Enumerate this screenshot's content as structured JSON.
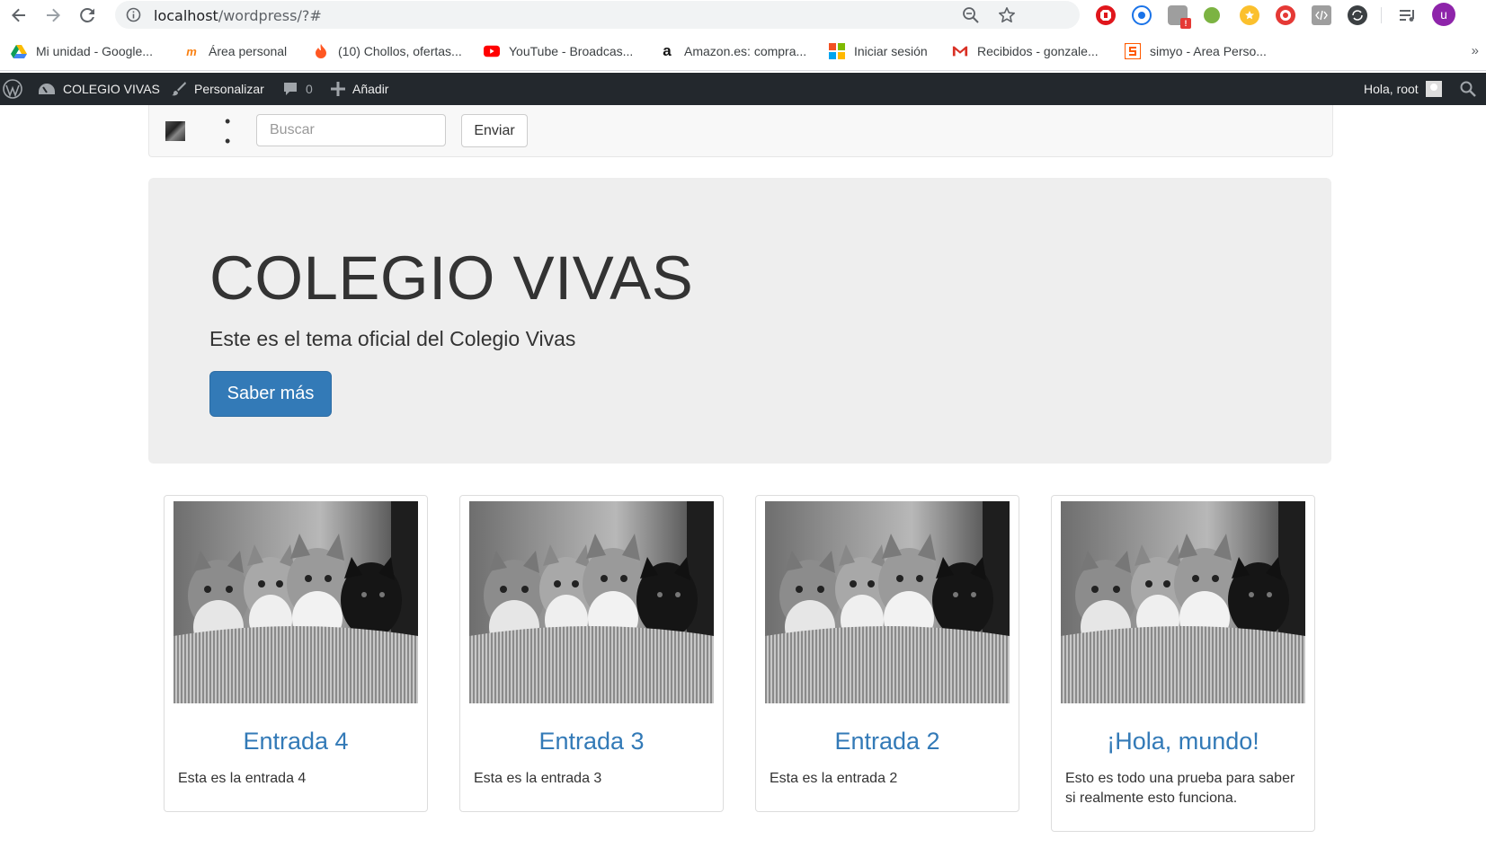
{
  "browser": {
    "url_host": "localhost",
    "url_path": "/wordpress/?#",
    "profile_initial": "u",
    "extensions": [
      "adblock-icon",
      "circle-extension-icon",
      "notes-extension-icon",
      "js-extension-icon",
      "star-extension-icon",
      "target-extension-icon",
      "code-extension-icon",
      "sync-extension-icon"
    ],
    "ext_badge": "!"
  },
  "bookmarks": [
    {
      "label": "Mi unidad - Google...",
      "icon": "google-drive-icon"
    },
    {
      "label": "Área personal",
      "icon": "moodle-icon"
    },
    {
      "label": "(10) Chollos, ofertas...",
      "icon": "flame-icon"
    },
    {
      "label": "YouTube - Broadcas...",
      "icon": "youtube-icon"
    },
    {
      "label": "Amazon.es: compra...",
      "icon": "amazon-icon"
    },
    {
      "label": "Iniciar sesión",
      "icon": "microsoft-icon"
    },
    {
      "label": "Recibidos - gonzale...",
      "icon": "gmail-icon"
    },
    {
      "label": "simyo - Area Perso...",
      "icon": "simyo-icon"
    }
  ],
  "bookmarks_more": "»",
  "adminbar": {
    "site": "COLEGIO VIVAS",
    "customize": "Personalizar",
    "comments": "0",
    "add": "Añadir",
    "greeting": "Hola, root"
  },
  "navbar": {
    "dots": "•\n•",
    "search_placeholder": "Buscar",
    "submit": "Enviar"
  },
  "hero": {
    "title": "COLEGIO VIVAS",
    "subtitle": "Este es el tema oficial del Colegio Vivas",
    "button": "Saber más"
  },
  "posts": [
    {
      "title": "Entrada 4",
      "excerpt": "Esta es la entrada 4"
    },
    {
      "title": "Entrada 3",
      "excerpt": "Esta es la entrada 3"
    },
    {
      "title": "Entrada 2",
      "excerpt": "Esta es la entrada 2"
    },
    {
      "title": "¡Hola, mundo!",
      "excerpt": "Esto es todo una prueba para saber si realmente esto funciona."
    }
  ],
  "colors": {
    "link": "#337ab7",
    "adminbar": "#23282d",
    "jumbotron": "#eeeeee"
  }
}
